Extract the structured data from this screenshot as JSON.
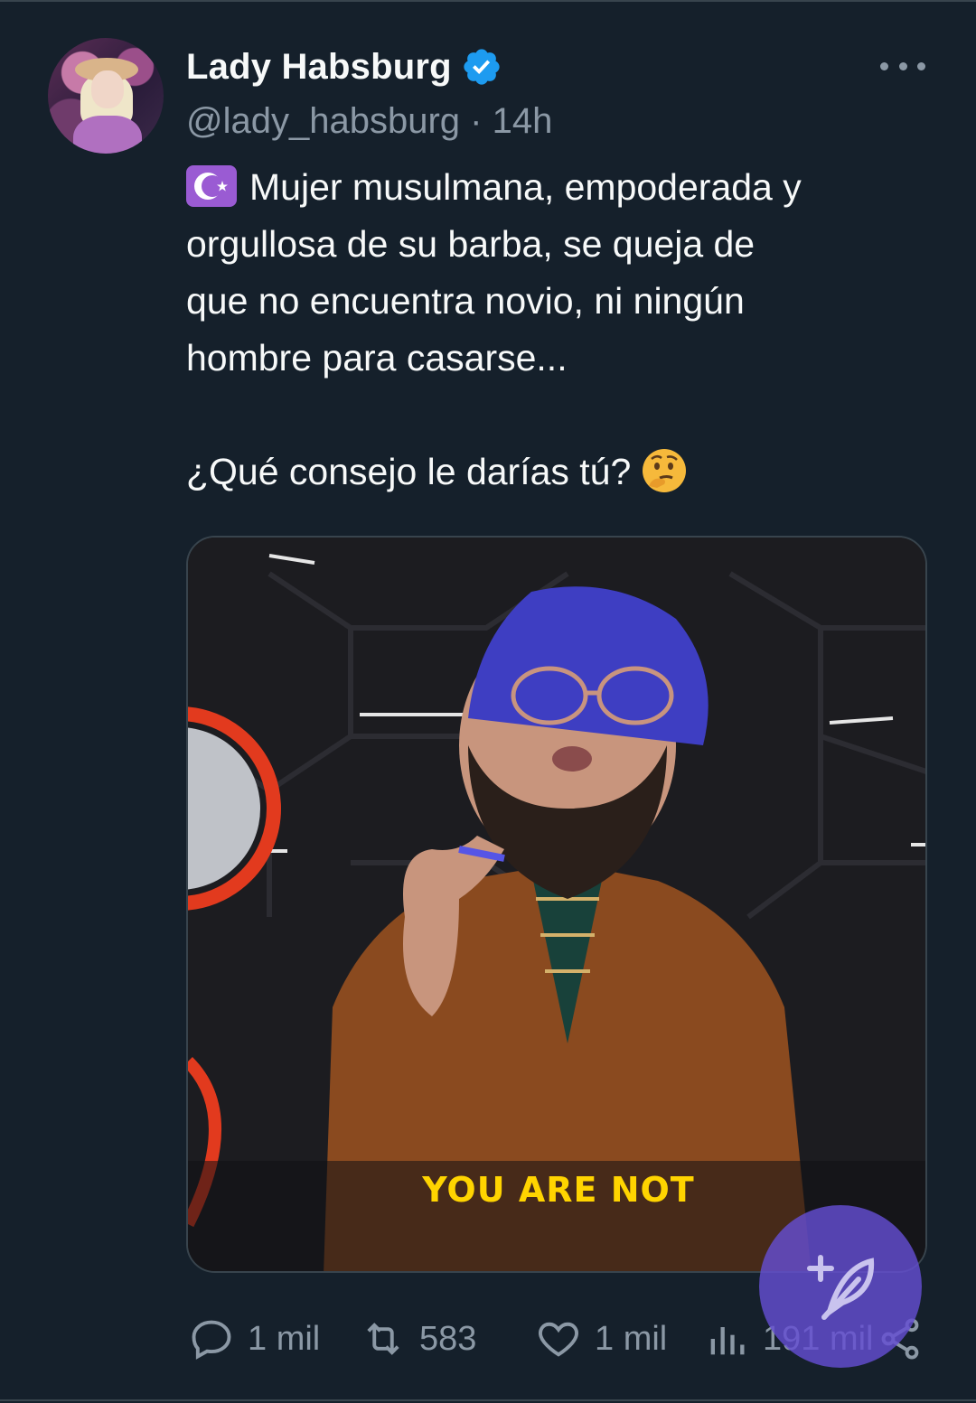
{
  "tweet": {
    "display_name": "Lady Habsburg",
    "verified": true,
    "handle": "@lady_habsburg",
    "separator": "·",
    "time": "14h",
    "text_line_1": "Mujer musulmana, empoderada y",
    "text_line_2": "orgullosa de su barba, se queja de",
    "text_line_3": "que no encuentra novio, ni ningún",
    "text_line_4": "hombre para casarse...",
    "question": "¿Qué consejo le darías tú?",
    "leading_icon": "star-and-crescent-icon",
    "trailing_icon": "thinking-face-icon"
  },
  "media": {
    "caption_part_1": "YOU ARE",
    "caption_part_2": "NOT"
  },
  "actions": {
    "replies": "1 mil",
    "reposts": "583",
    "likes": "1 mil",
    "views": "191 mil"
  },
  "colors": {
    "background": "#15202b",
    "secondary_text": "#8b98a5",
    "verified_blue": "#1d9bf0",
    "compose_fab": "#644ed2"
  }
}
